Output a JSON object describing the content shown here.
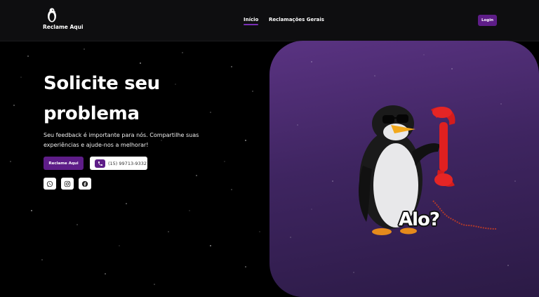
{
  "navbar": {
    "logo_text": "Reclame Aqui",
    "links": [
      {
        "label": "Início",
        "active": true
      },
      {
        "label": "Reclamações Gerais",
        "active": false
      }
    ],
    "login_label": "Login"
  },
  "hero": {
    "title_line1": "Solicite seu",
    "title_line2": "problema",
    "subtitle": "Seu feedback é importante para nós. Compartilhe suas experiências e ajude-nos a melhorar!",
    "primary_button": "Reclame Aqui",
    "phone": "(15) 99713-9332",
    "social_icons": [
      "whatsapp-icon",
      "instagram-icon",
      "facebook-icon"
    ]
  },
  "image": {
    "caption": "Alo?"
  },
  "colors": {
    "accent": "#5e1d88",
    "panel": "#4a2c6e",
    "background": "#000000"
  }
}
